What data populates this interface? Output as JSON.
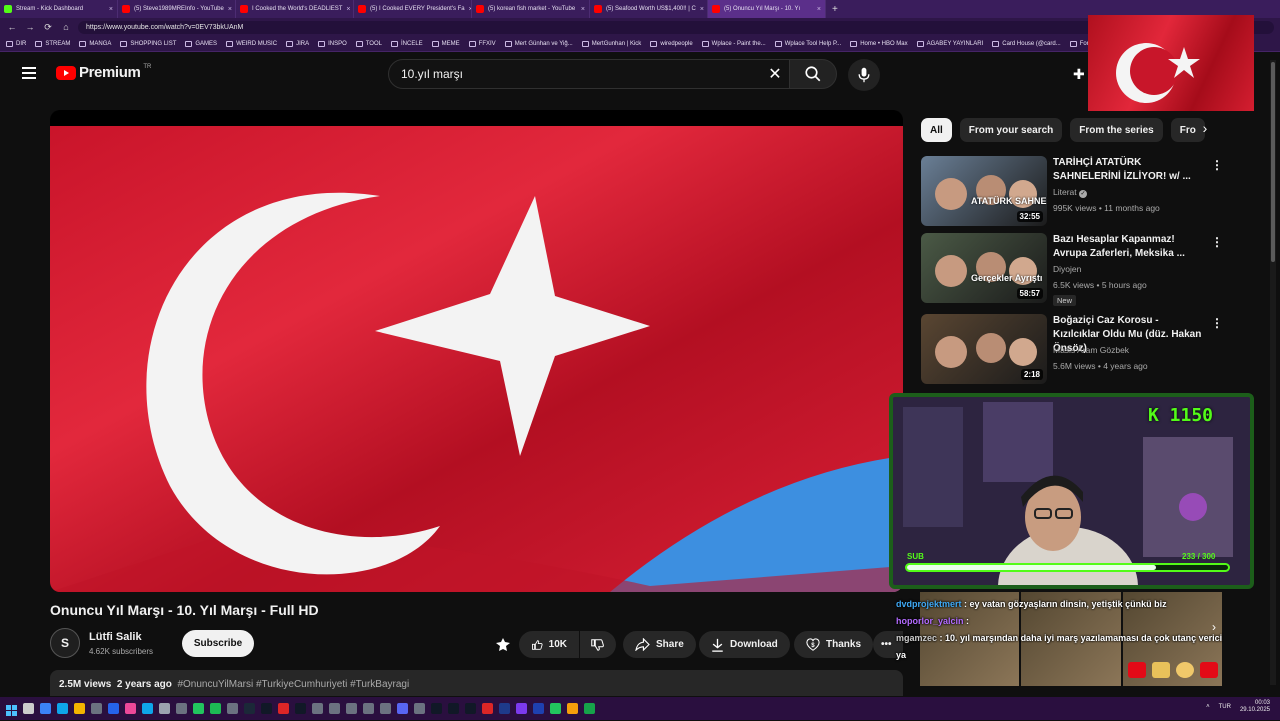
{
  "browser": {
    "tabs": [
      {
        "title": "Stream - Kick Dashboard",
        "color": "#53fc18",
        "active": false
      },
      {
        "title": "(5) Steve1989MREInfo - YouTube",
        "color": "#ff0000",
        "active": false
      },
      {
        "title": "I Cooked the World's DEADLIEST",
        "color": "#ff0000",
        "active": false
      },
      {
        "title": "(5) I Cooked EVERY President's Fa",
        "color": "#ff0000",
        "active": false
      },
      {
        "title": "(5) korean fish market - YouTube",
        "color": "#ff0000",
        "active": false
      },
      {
        "title": "(5) Seafood Worth US$1,400!! | C",
        "color": "#ff0000",
        "active": false
      },
      {
        "title": "(5) Onuncu Yıl Marşı - 10. Yı",
        "color": "#ff0000",
        "active": true
      }
    ],
    "new_tab": "+",
    "url": "https://www.youtube.com/watch?v=0EV73bkUAnM",
    "bookmarks": [
      "DIR",
      "STREAM",
      "MANGA",
      "SHOPPING LIST",
      "GAMES",
      "WEIRD MUSIC",
      "JIRA",
      "INSPO",
      "TOOL",
      "İNCELE",
      "MEME",
      "FFXIV",
      "Mert Günhan ve Yiğ...",
      "MertGunhan | Kick",
      "wiredpeople",
      "Wplace - Paint the...",
      "Wplace Tool Help P...",
      "Home • HBO Max",
      "AGABEY YAYINLARI",
      "Card House (@card...",
      "Fort"
    ]
  },
  "header": {
    "logo_text": "Premium",
    "country_code": "TR",
    "search_value": "10.yıl marşı"
  },
  "video": {
    "title": "Onuncu Yıl Marşı - 10. Yıl Marşı - Full HD",
    "channel": "Lütfi Salik",
    "channel_initial": "S",
    "subscribers": "4.62K subscribers",
    "subscribe_label": "Subscribe",
    "like_count": "10K",
    "share_label": "Share",
    "download_label": "Download",
    "thanks_label": "Thanks",
    "more_label": "•••",
    "views": "2.5M views",
    "age": "2 years ago",
    "hashtags": "#OnuncuYilMarsi #TurkiyeCumhuriyeti #TurkBayragi"
  },
  "chips": [
    "All",
    "From your search",
    "From the series",
    "Fro"
  ],
  "recommendations": [
    {
      "title": "TARİHÇİ ATATÜRK SAHNELERİNİ İZLİYOR! w/ ...",
      "channel": "Literat",
      "verified": true,
      "views": "995K views",
      "age": "11 months ago",
      "duration": "32:55",
      "badge": "",
      "thumb_text": "ATATÜRK SAHNE",
      "thumb_color": "#6a7f96"
    },
    {
      "title": "Bazı Hesaplar Kapanmaz! Avrupa Zaferleri, Meksika ...",
      "channel": "Diyojen",
      "verified": false,
      "views": "6.5K views",
      "age": "5 hours ago",
      "duration": "58:57",
      "badge": "New",
      "thumb_text": "Gerçekler Ayrıştı",
      "thumb_color": "#4b5a46"
    },
    {
      "title": "Boğaziçi Caz Korosu - Kızılcıklar Oldu Mu (düz. Hakan Önsöz)",
      "channel": "Masis Aram Gözbek",
      "verified": false,
      "views": "5.6M views",
      "age": "4 years ago",
      "duration": "2:18",
      "badge": "",
      "thumb_text": "",
      "thumb_color": "#5a4632"
    }
  ],
  "stream_overlay": {
    "kick_count": "K 1150",
    "sub_label": "SUB",
    "sub_count": "233 / 300",
    "sub_progress": 0.7767
  },
  "chat": [
    {
      "user": "dvdprojektmert",
      "message": "ey vatan gözyaşların dinsin, yetiştik çünkü biz",
      "class": "u1"
    },
    {
      "user": "hoporlor_yalcin",
      "message": "",
      "class": "u2"
    },
    {
      "user": "mgamzec",
      "message": "10. yıl marşından daha iyi marş yazılamaması da çok utanç verici ya",
      "class": "u3"
    }
  ],
  "tray": {
    "lang": "TUR",
    "time": "00:03",
    "date": "29.10.2025"
  },
  "colors": {
    "accent": "#ff0000",
    "kick_green": "#53fc18",
    "flag_red": "#e30a17"
  }
}
